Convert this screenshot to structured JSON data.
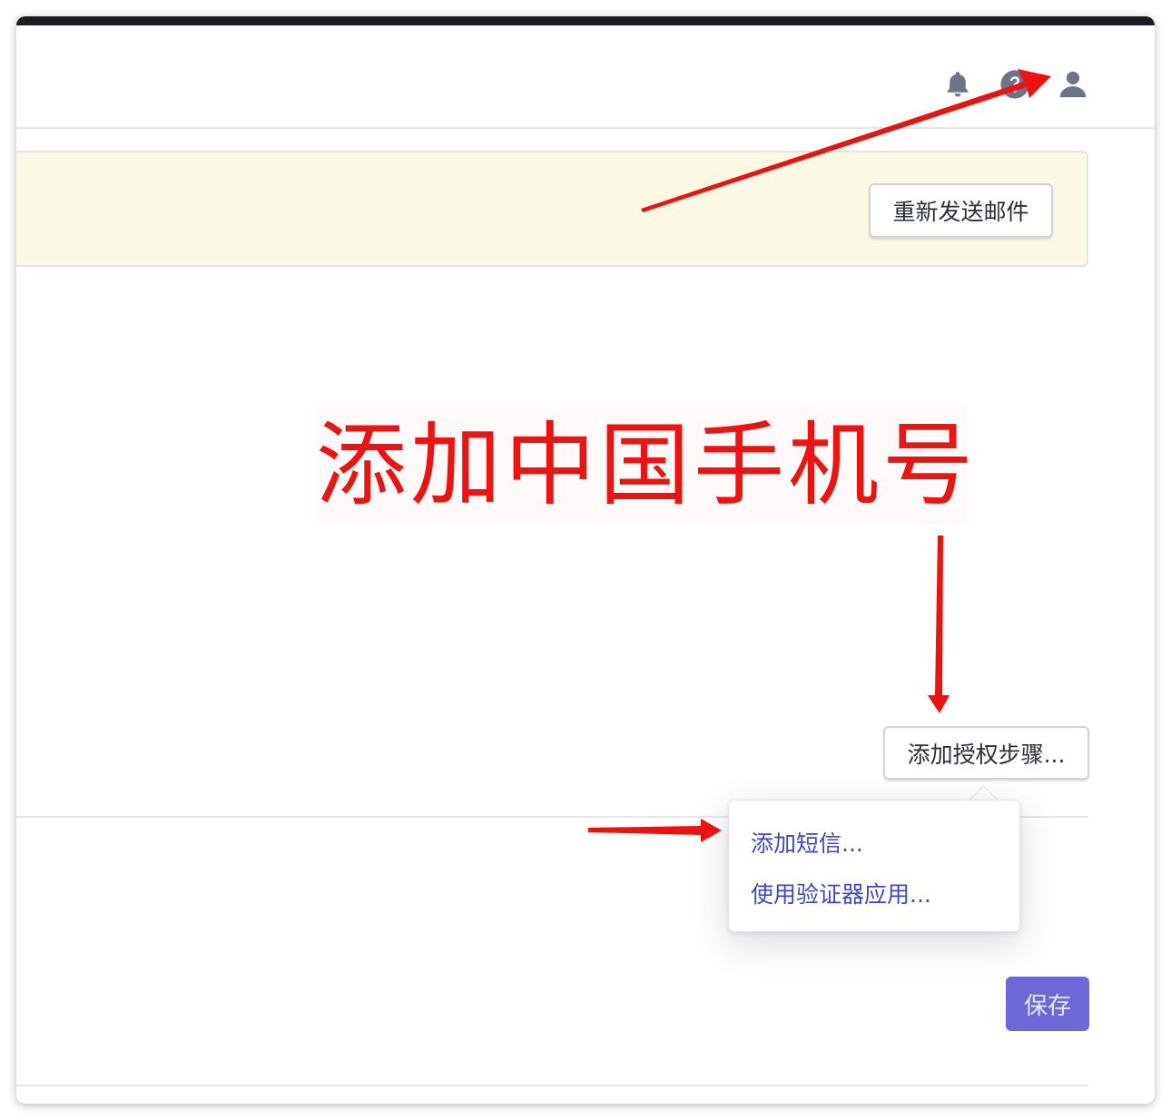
{
  "header": {
    "icons": [
      {
        "name": "bell-icon",
        "label": "notifications"
      },
      {
        "name": "help-icon",
        "label": "help"
      },
      {
        "name": "user-icon",
        "label": "account"
      }
    ]
  },
  "banner": {
    "resend_button": "重新发送邮件"
  },
  "annotation": {
    "label": "添加中国手机号",
    "color": "#ef1212"
  },
  "auth": {
    "add_step_button": "添加授权步骤...",
    "menu": [
      {
        "label": "添加短信..."
      },
      {
        "label": "使用验证器应用..."
      }
    ]
  },
  "footer": {
    "save_button": "保存"
  },
  "colors": {
    "accent": "#6d68d8",
    "link": "#3e47c4",
    "banner_bg": "#fbf8e4",
    "icon": "#6b7587"
  }
}
